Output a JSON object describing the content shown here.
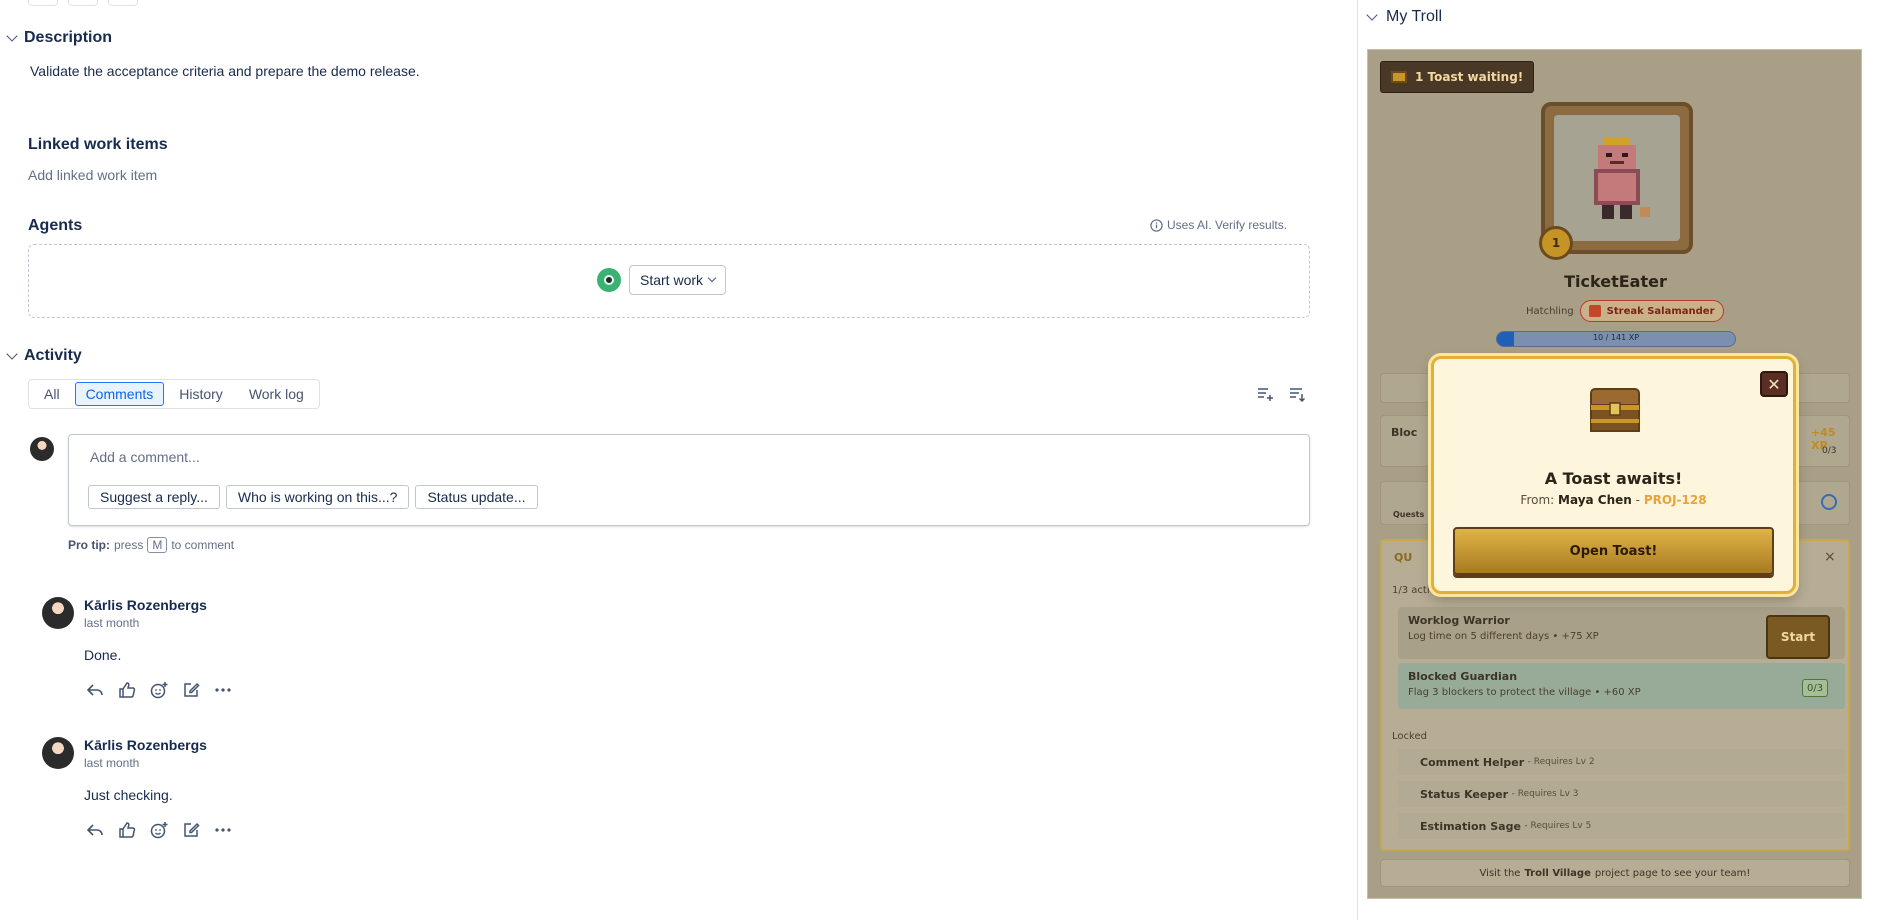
{
  "description": {
    "title": "Description",
    "text": "Validate the acceptance criteria and prepare the demo release."
  },
  "linked": {
    "title": "Linked work items",
    "add_label": "Add linked work item"
  },
  "agents": {
    "title": "Agents",
    "ai_note": "Uses AI. Verify results.",
    "start_label": "Start work"
  },
  "activity": {
    "title": "Activity",
    "tabs": [
      "All",
      "Comments",
      "History",
      "Work log"
    ],
    "active_tab": "Comments",
    "comment_placeholder": "Add a comment...",
    "suggestions": [
      "Suggest a reply...",
      "Who is working on this...?",
      "Status update..."
    ],
    "pro_tip_label": "Pro tip:",
    "pro_tip_press": "press",
    "pro_tip_key": "M",
    "pro_tip_suffix": "to comment",
    "comments": [
      {
        "author": "Kārlis Rozenbergs",
        "time": "last month",
        "body": "Done."
      },
      {
        "author": "Kārlis Rozenbergs",
        "time": "last month",
        "body": "Just checking."
      }
    ]
  },
  "troll": {
    "panel_title": "My Troll",
    "toast_badge": "1 Toast waiting!",
    "level": "1",
    "name": "TicketEater",
    "stage": "Hatchling",
    "streak_badge": "Streak Salamander",
    "xp_text": "10 / 141 XP",
    "xp_progress": 0.07,
    "partial_row_label": "Bloc",
    "partial_xp": "+45 XP",
    "partial_count": "0/3",
    "quests_tab": "Quests",
    "quests_header": "QU",
    "active_count": "1/3 activ",
    "quests": [
      {
        "title": "Worklog Warrior",
        "desc": "Log time on 5 different days • +75 XP",
        "action": "Start"
      },
      {
        "title": "Blocked Guardian",
        "desc": "Flag 3 blockers to protect the village • +60 XP",
        "progress": "0/3"
      }
    ],
    "locked_label": "Locked",
    "locked": [
      {
        "name": "Comment Helper",
        "req": "- Requires Lv 2"
      },
      {
        "name": "Status Keeper",
        "req": "- Requires Lv 3"
      },
      {
        "name": "Estimation Sage",
        "req": "- Requires Lv 5"
      }
    ],
    "footer_prefix": "Visit the",
    "footer_link": "Troll Village",
    "footer_suffix": "project page to see your team!",
    "modal": {
      "title": "A Toast awaits!",
      "from_label": "From:",
      "from_name": "Maya Chen",
      "from_ticket": "PROJ-128",
      "open_label": "Open Toast!"
    },
    "colors": {
      "gold": "#c9962c",
      "panel": "#a99f86",
      "modal_bg": "#fdf5dc",
      "link": "#e8a33a"
    }
  }
}
